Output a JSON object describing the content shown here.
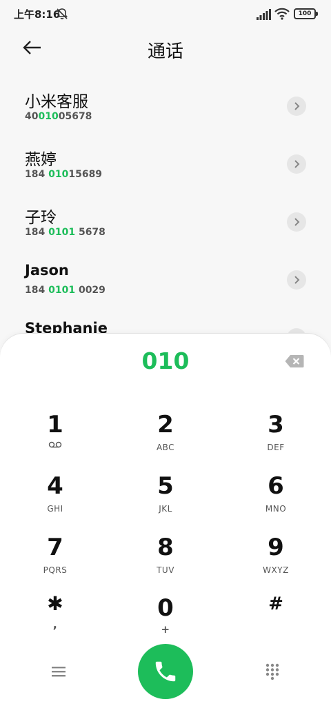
{
  "status_bar": {
    "time": "上午8:16",
    "battery": "100"
  },
  "header": {
    "title": "通话"
  },
  "results": [
    {
      "name": "小米客服",
      "number_parts": [
        "40",
        "010",
        "05678"
      ]
    },
    {
      "name": "燕婷",
      "number_parts": [
        "184 ",
        "010",
        "15689"
      ]
    },
    {
      "name": "子玲",
      "number_parts": [
        "184 ",
        "0101",
        " 5678"
      ]
    },
    {
      "name": "Jason",
      "number_parts": [
        "184 ",
        "0101",
        " 0029"
      ]
    },
    {
      "name": "Stephanie",
      "number_parts": [
        "",
        "",
        ""
      ]
    }
  ],
  "dialpad": {
    "dialed": "010",
    "keys": [
      {
        "digit": "1",
        "letters": ""
      },
      {
        "digit": "2",
        "letters": "ABC"
      },
      {
        "digit": "3",
        "letters": "DEF"
      },
      {
        "digit": "4",
        "letters": "GHI"
      },
      {
        "digit": "5",
        "letters": "JKL"
      },
      {
        "digit": "6",
        "letters": "MNO"
      },
      {
        "digit": "7",
        "letters": "PQRS"
      },
      {
        "digit": "8",
        "letters": "TUV"
      },
      {
        "digit": "9",
        "letters": "WXYZ"
      },
      {
        "digit": "✱",
        "letters": ","
      },
      {
        "digit": "0",
        "letters": "+"
      },
      {
        "digit": "#",
        "letters": ""
      }
    ]
  },
  "colors": {
    "accent": "#1dbd5a",
    "background": "#f7f7f7",
    "pad": "#ffffff"
  },
  "icons": [
    "bell-muted-icon",
    "signal-icon",
    "wifi-icon",
    "battery-icon",
    "back-arrow-icon",
    "chevron-right-icon",
    "backspace-icon",
    "voicemail-icon",
    "menu-icon",
    "phone-icon",
    "dialpad-grid-icon"
  ]
}
